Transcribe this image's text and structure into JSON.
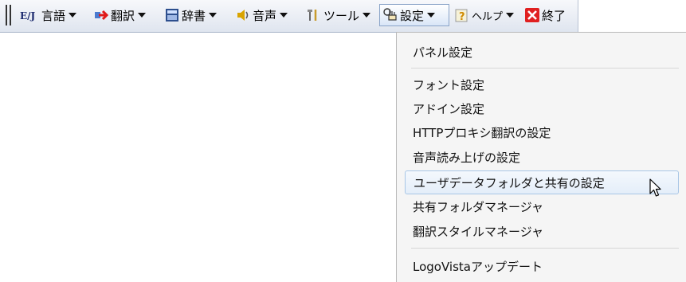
{
  "toolbar": {
    "items": [
      {
        "label": "言語",
        "badge": "E/J",
        "icon": "ej-badge-icon"
      },
      {
        "label": "翻訳",
        "icon": "translate-arrow-icon"
      },
      {
        "label": "辞書",
        "icon": "dictionary-icon"
      },
      {
        "label": "音声",
        "icon": "speaker-icon"
      },
      {
        "label": "ツール",
        "icon": "tools-icon"
      },
      {
        "label": "設定",
        "icon": "settings-hand-icon"
      },
      {
        "label": "ヘルプ",
        "icon": "help-icon"
      },
      {
        "label": "終了",
        "icon": "close-icon"
      }
    ]
  },
  "settings_menu": {
    "items": [
      "パネル設定",
      "フォント設定",
      "アドイン設定",
      "HTTPプロキシ翻訳の設定",
      "音声読み上げの設定",
      "ユーザデータフォルダと共有の設定",
      "共有フォルダマネージャ",
      "翻訳スタイルマネージャ",
      "LogoVistaアップデート"
    ],
    "highlighted": "ユーザデータフォルダと共有の設定"
  },
  "colors": {
    "toolbar_bg": "#e6ebf3",
    "menu_bg": "#f5f5f5",
    "highlight": "#e4eef9",
    "close_red": "#e02020"
  }
}
